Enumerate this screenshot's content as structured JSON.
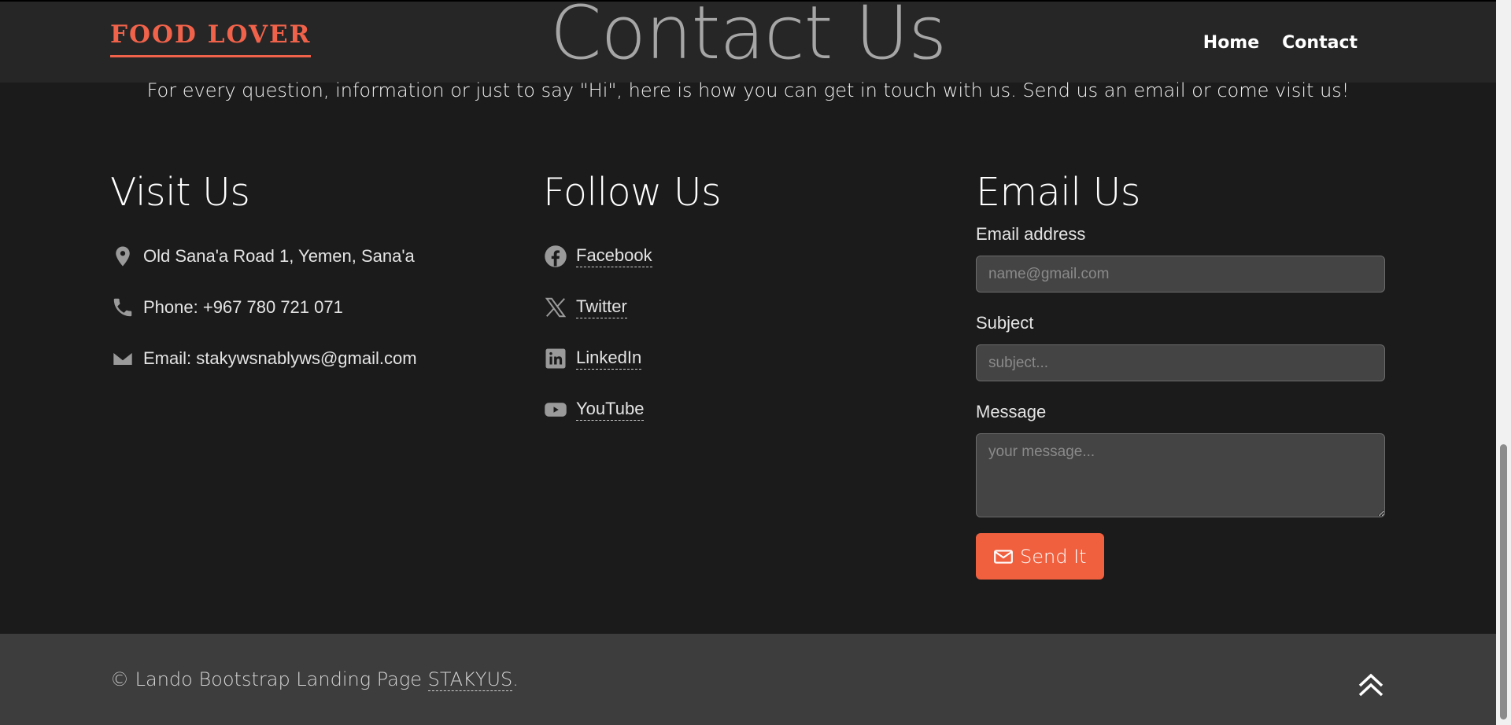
{
  "header": {
    "brand": "FOOD LOVER",
    "nav": [
      "Home",
      "Contact"
    ]
  },
  "page": {
    "title": "Contact Us",
    "intro": "For every question, information or just to say \"Hi\", here is how you can get in touch with us. Send us an email or come visit us!"
  },
  "visit": {
    "heading": "Visit Us",
    "items": [
      {
        "icon": "map-pin-icon",
        "text": "Old Sana'a Road 1, Yemen, Sana'a"
      },
      {
        "icon": "phone-icon",
        "text": "Phone: +967 780 721 071"
      },
      {
        "icon": "envelope-icon",
        "text": "Email: stakywsnablyws@gmail.com"
      }
    ]
  },
  "follow": {
    "heading": "Follow Us",
    "items": [
      {
        "icon": "facebook-icon",
        "text": "Facebook"
      },
      {
        "icon": "x-twitter-icon",
        "text": "Twitter"
      },
      {
        "icon": "linkedin-icon",
        "text": "LinkedIn"
      },
      {
        "icon": "youtube-icon",
        "text": "YouTube"
      }
    ]
  },
  "email_form": {
    "heading": "Email Us",
    "email_label": "Email address",
    "email_placeholder": "name@gmail.com",
    "subject_label": "Subject",
    "subject_placeholder": "subject...",
    "message_label": "Message",
    "message_placeholder": "your message...",
    "send_label": "Send It"
  },
  "footer": {
    "copyright": "© Lando Bootstrap Landing Page ",
    "author": "STAKYUS",
    "suffix": "."
  },
  "colors": {
    "accent": "#f0603f",
    "background": "#1b1b1b",
    "header_bg": "#262626",
    "footer_bg": "#3d3d3d"
  }
}
